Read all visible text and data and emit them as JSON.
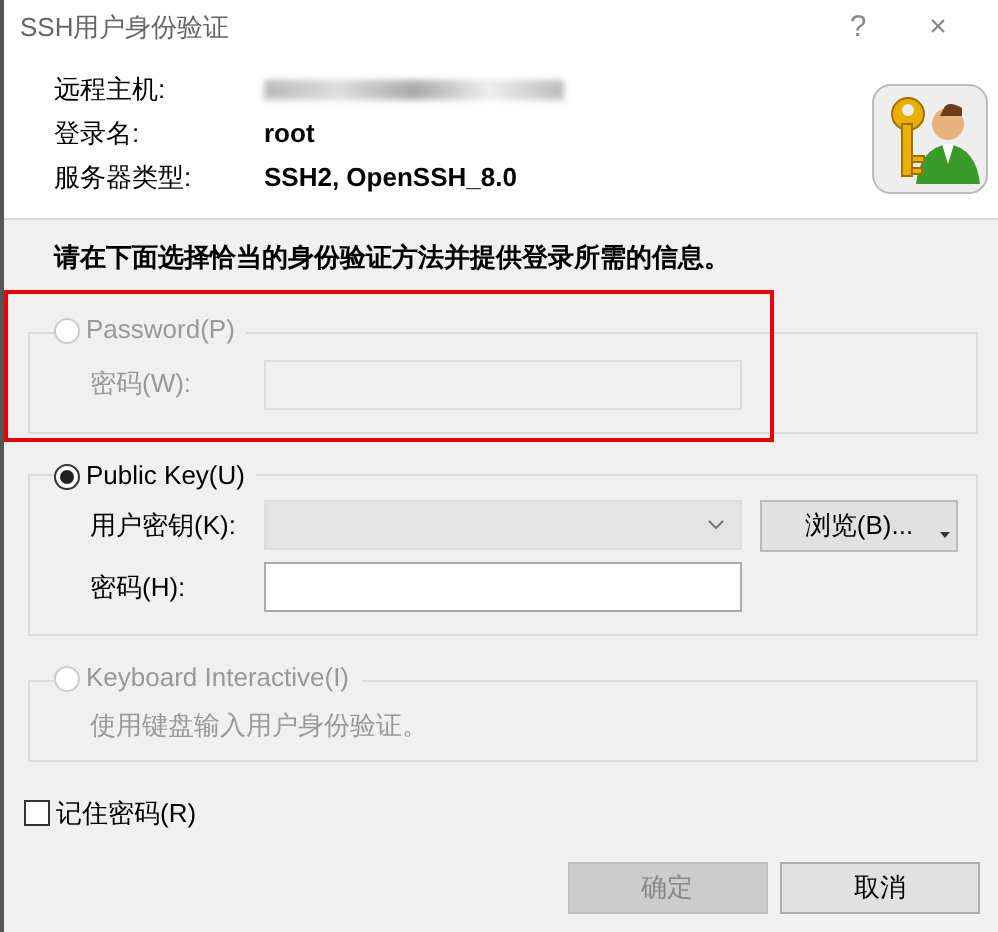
{
  "window": {
    "title": "SSH用户身份验证",
    "buttons": [
      "?",
      "×"
    ]
  },
  "info": [
    {
      "label": "远程主机:",
      "kind": "redacted"
    },
    {
      "label": "登录名:",
      "kind": "text",
      "value": "root"
    },
    {
      "label": "服务器类型:",
      "kind": "text",
      "value": "SSH2, OpenSSH_8.0"
    }
  ],
  "instruction": "请在下面选择恰当的身份验证方法并提供登录所需的信息。",
  "methods": [
    {
      "label": "Password(P)",
      "selected": false,
      "disabled": true,
      "highlighted": true,
      "fields": [
        {
          "kind": "input",
          "label": "密码(W):",
          "disabled": true
        }
      ]
    },
    {
      "label": "Public Key(U)",
      "selected": true,
      "disabled": false,
      "highlighted": false,
      "fields": [
        {
          "kind": "select",
          "label": "用户密钥(K):",
          "disabled": true,
          "button": "浏览(B)..."
        },
        {
          "kind": "input",
          "label": "密码(H):",
          "disabled": false
        }
      ]
    },
    {
      "label": "Keyboard Interactive(I)",
      "selected": false,
      "disabled": true,
      "highlighted": false,
      "fields": [
        {
          "kind": "note",
          "text": "使用键盘输入用户身份验证。"
        }
      ]
    }
  ],
  "remember": {
    "label": "记住密码(R)",
    "checked": false
  },
  "buttons": [
    {
      "label": "确定",
      "disabled": true
    },
    {
      "label": "取消",
      "disabled": false
    }
  ]
}
